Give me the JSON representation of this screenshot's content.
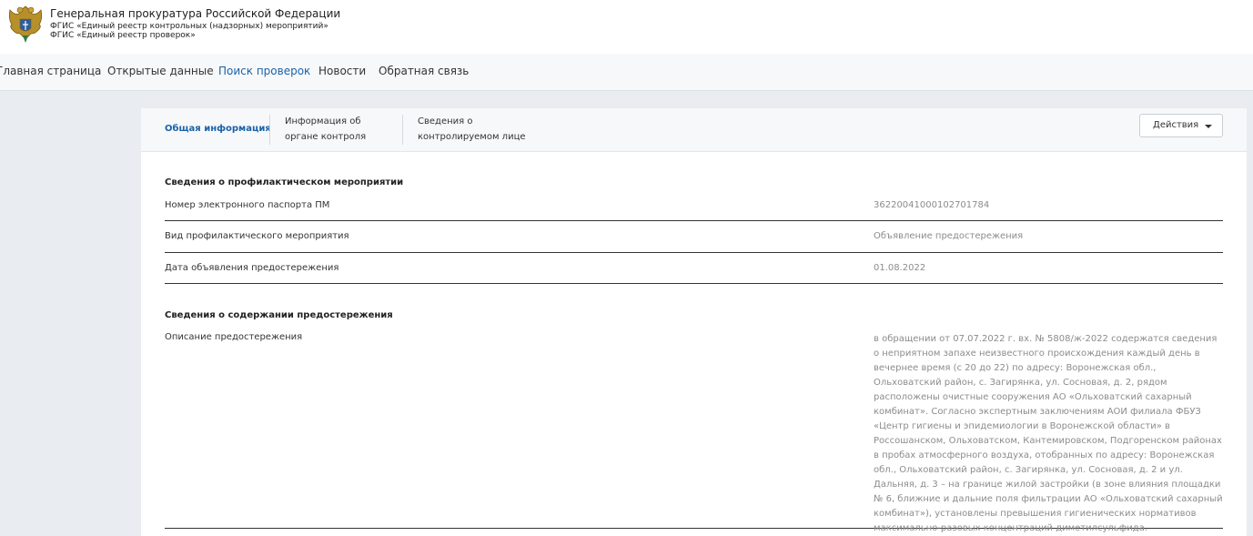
{
  "header": {
    "org_title": "Генеральная прокуратура Российской Федерации",
    "subtitle_1": "ФГИС «Единый реестр контрольных (надзорных) мероприятий»",
    "subtitle_2": "ФГИС «Единый реестр проверок»",
    "emblem_icon": "coat-of-arms"
  },
  "nav": {
    "items": [
      {
        "label": "Главная страница"
      },
      {
        "label": "Открытые данные"
      },
      {
        "label": "Поиск проверок"
      },
      {
        "label": "Новости"
      },
      {
        "label": "Обратная связь"
      }
    ],
    "active_index": 2,
    "active_color": "#1b62a8"
  },
  "tabs": {
    "items": [
      {
        "line1": "Общая информация",
        "line2": ""
      },
      {
        "line1": "Информация об",
        "line2": "органе контроля"
      },
      {
        "line1": "Сведения о",
        "line2": "контролируемом лице"
      }
    ],
    "active_index": 0
  },
  "actions": {
    "label": "Действия",
    "icon": "caret-down-icon"
  },
  "sections": [
    {
      "title": "Сведения о профилактическом мероприятии",
      "rows": [
        {
          "label": "Номер электронного паспорта ПМ",
          "value": "36220041000102701784"
        },
        {
          "label": "Вид профилактического мероприятия",
          "value": "Объявление предостережения"
        },
        {
          "label": "Дата объявления предостережения",
          "value": "01.08.2022"
        }
      ]
    },
    {
      "title": "Сведения о содержании предостережения",
      "rows": [
        {
          "label": "Описание предостережения",
          "value": "в обращении от 07.07.2022 г. вх. № 5808/ж-2022 содержатся сведения о неприятном запахе неизвестного происхождения каждый день в вечернее время (с 20 до 22) по адресу: Воронежская обл., Ольховатский район, с. Загирянка, ул. Сосновая, д. 2, рядом расположены очистные сооружения АО «Ольховатский сахарный комбинат». Согласно экспертным заключениям АОИ филиала ФБУЗ «Центр гигиены и эпидемиологии в Воронежской области» в Россошанском, Ольховатском, Кантемировском, Подгоренском районах в пробах атмосферного воздуха, отобранных по адресу: Воронежская обл., Ольховатский район, с. Загирянка, ул. Сосновая, д. 2 и ул. Дальняя, д. 3 – на границе жилой застройки (в зоне влияния площадки № 6, ближние и дальние поля фильтрации АО «Ольховатский сахарный комбинат»), установлены превышения гигиенических нормативов максимально-разовых концентраций диметилсульфида."
        }
      ]
    }
  ]
}
